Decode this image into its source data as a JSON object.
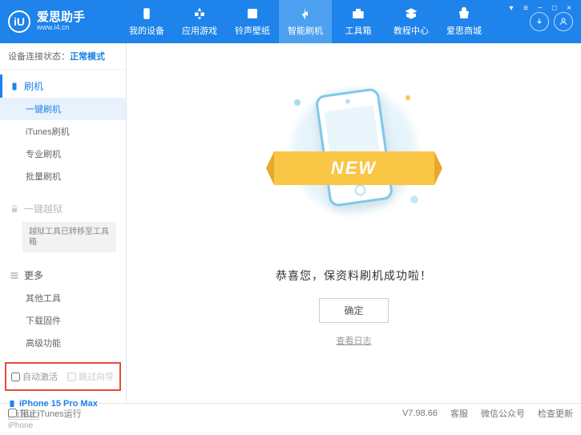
{
  "header": {
    "logo_letter": "iU",
    "title": "爱思助手",
    "url": "www.i4.cn",
    "nav": [
      {
        "label": "我的设备"
      },
      {
        "label": "应用游戏"
      },
      {
        "label": "铃声壁纸"
      },
      {
        "label": "智能刷机"
      },
      {
        "label": "工具箱"
      },
      {
        "label": "教程中心"
      },
      {
        "label": "爱思商城"
      }
    ]
  },
  "status": {
    "prefix": "设备连接状态：",
    "mode": "正常模式"
  },
  "sidebar": {
    "flash": {
      "title": "刷机",
      "items": [
        "一键刷机",
        "iTunes刷机",
        "专业刷机",
        "批量刷机"
      ]
    },
    "jailbreak": {
      "title": "一键越狱",
      "note": "越狱工具已转移至工具箱"
    },
    "more": {
      "title": "更多",
      "items": [
        "其他工具",
        "下载固件",
        "高级功能"
      ]
    },
    "checkboxes": {
      "auto_activate": "自动激活",
      "skip_guide": "跳过向导"
    },
    "device": {
      "name": "iPhone 15 Pro Max",
      "storage": "512GB",
      "type": "iPhone"
    }
  },
  "main": {
    "banner_text": "NEW",
    "success_text": "恭喜您，保资料刷机成功啦！",
    "ok_button": "确定",
    "log_link": "查看日志"
  },
  "footer": {
    "block_itunes": "阻止iTunes运行",
    "version": "V7.98.66",
    "support": "客服",
    "wechat": "微信公众号",
    "update": "检查更新"
  }
}
